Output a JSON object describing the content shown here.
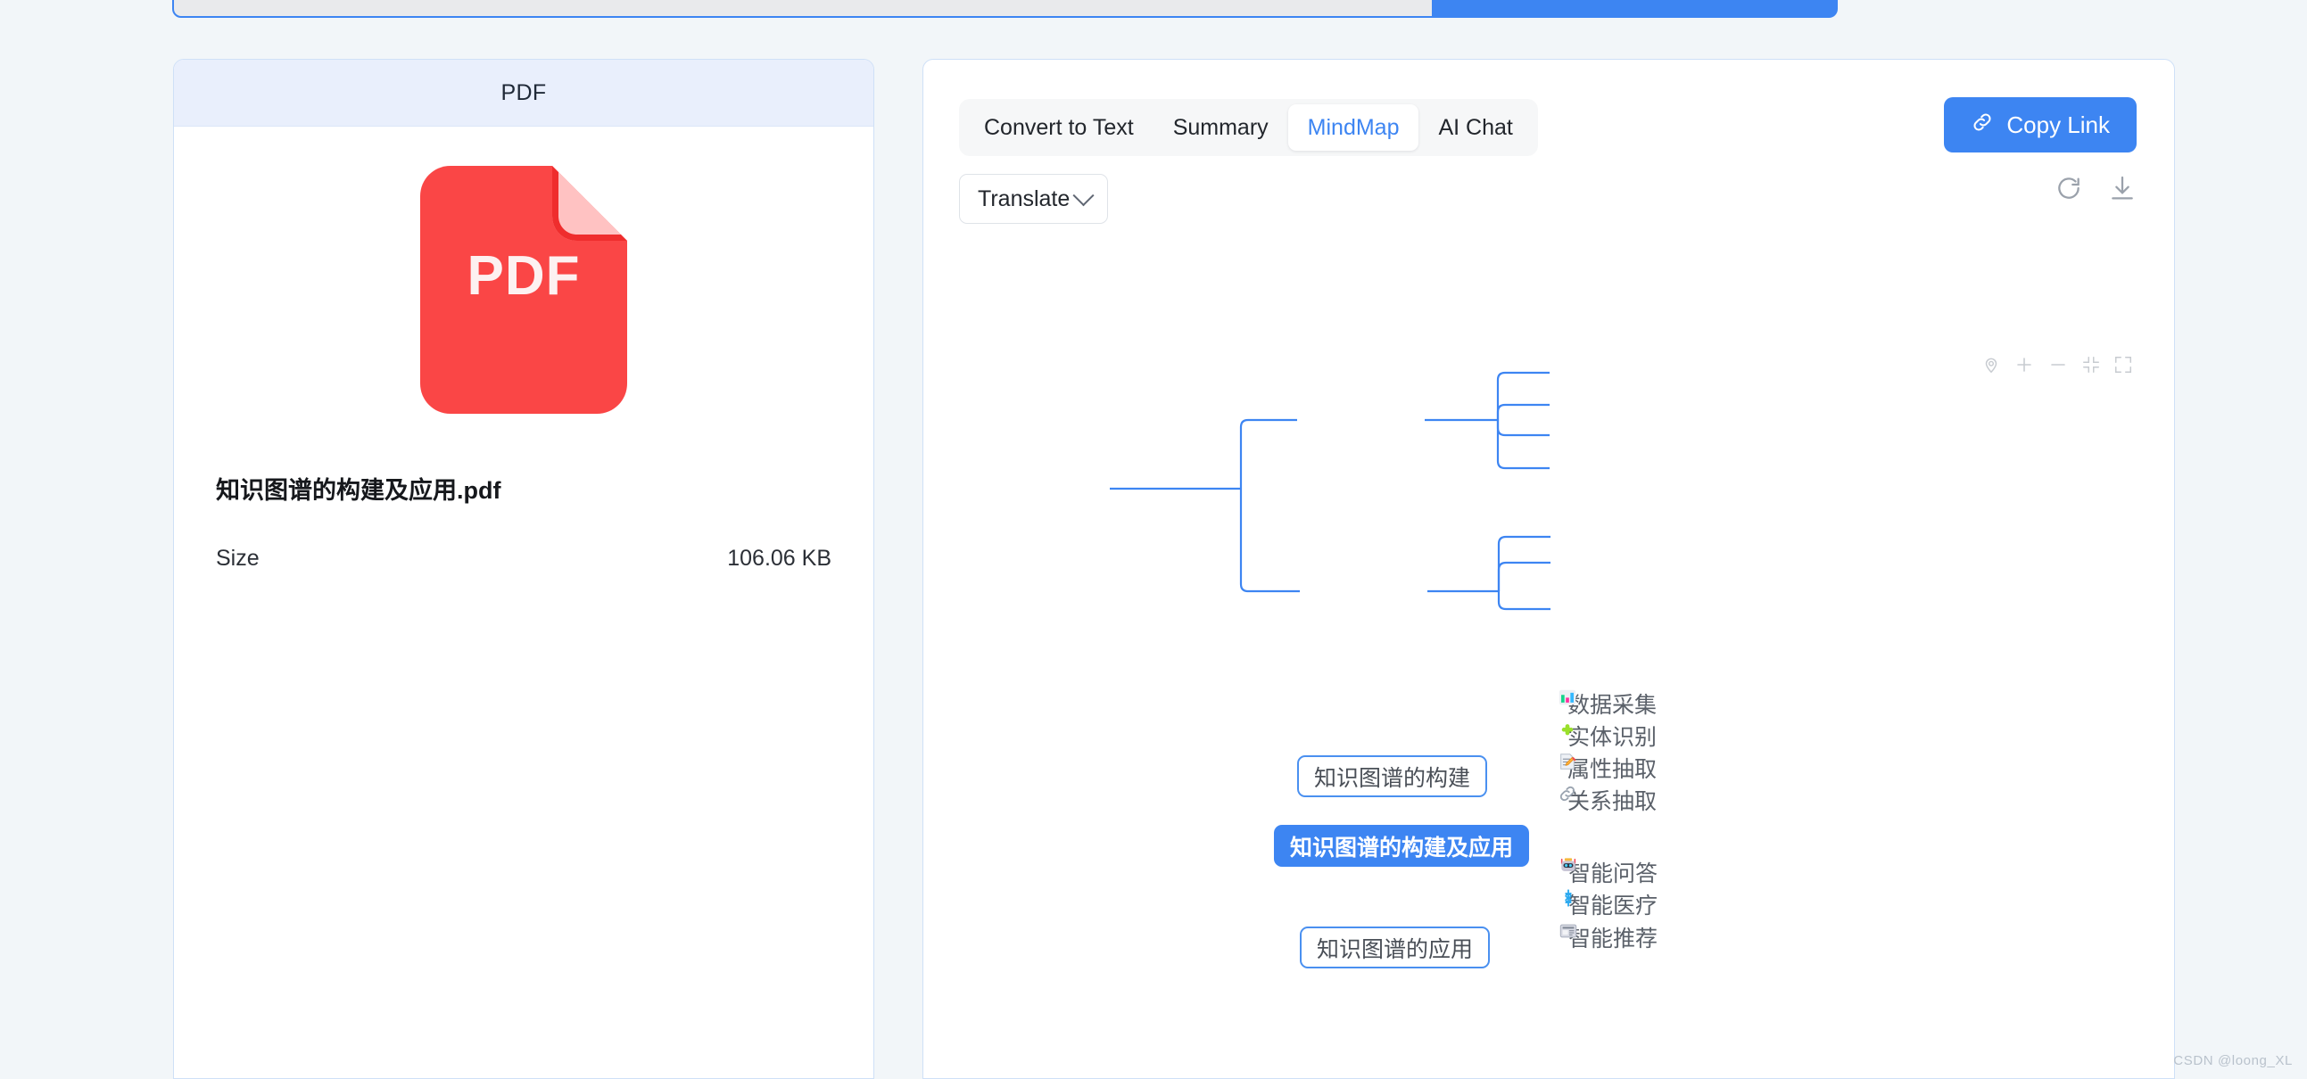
{
  "background_color": "#f2f6f9",
  "accent_color": "#3d85f2",
  "top_bar": {
    "input_value": "",
    "submit_label": ""
  },
  "pdf_panel": {
    "header_title": "PDF",
    "file_icon_label": "PDF",
    "file_icon_color": "#fa4646",
    "file_icon_fold_color": "#ffc2c2",
    "filename": "知识图谱的构建及应用.pdf",
    "size_label": "Size",
    "size_value": "106.06 KB"
  },
  "right_panel": {
    "tabs": [
      {
        "label": "Convert to Text",
        "active": false
      },
      {
        "label": "Summary",
        "active": false
      },
      {
        "label": "MindMap",
        "active": true
      },
      {
        "label": "AI Chat",
        "active": false
      }
    ],
    "translate_select": {
      "value": "Translate",
      "icon": "chevron-down-icon"
    },
    "copy_link": {
      "label": "Copy Link",
      "icon": "link-icon"
    },
    "action_icons": [
      {
        "name": "refresh-icon"
      },
      {
        "name": "download-icon"
      }
    ],
    "map_controls": [
      {
        "name": "locate-icon"
      },
      {
        "name": "zoom-in-icon"
      },
      {
        "name": "zoom-out-icon"
      },
      {
        "name": "fit-screen-icon"
      },
      {
        "name": "fullscreen-icon"
      }
    ]
  },
  "mindmap": {
    "root": "知识图谱的构建及应用",
    "branches": [
      {
        "label": "知识图谱的构建",
        "leaves": [
          {
            "icon": "bar-chart-icon",
            "label": "数据采集"
          },
          {
            "icon": "puzzle-piece-icon",
            "label": "实体识别"
          },
          {
            "icon": "memo-pencil-icon",
            "label": "属性抽取"
          },
          {
            "icon": "link-chain-icon",
            "label": "关系抽取"
          }
        ]
      },
      {
        "label": "知识图谱的应用",
        "leaves": [
          {
            "icon": "robot-icon",
            "label": "智能问答"
          },
          {
            "icon": "medical-symbol-icon",
            "label": "智能医疗"
          },
          {
            "icon": "newspaper-icon",
            "label": "智能推荐"
          }
        ]
      }
    ]
  },
  "watermark": "CSDN @loong_XL"
}
